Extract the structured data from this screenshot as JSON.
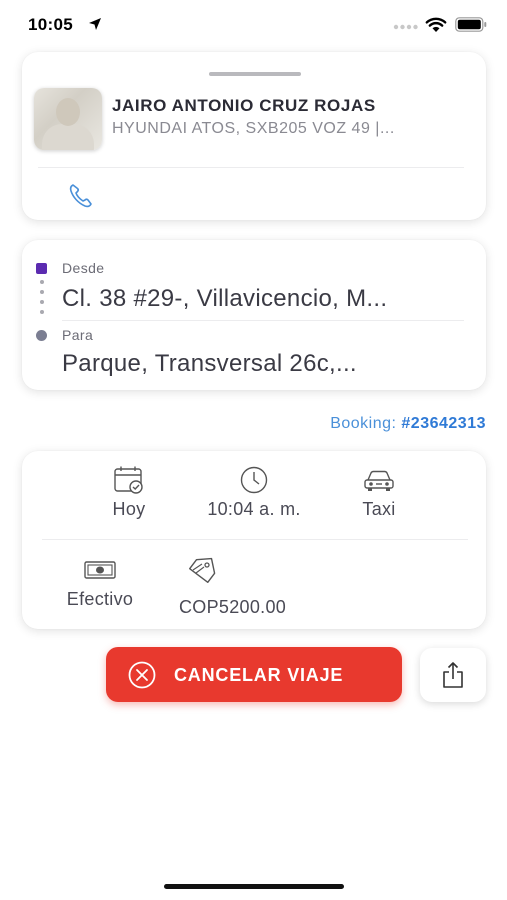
{
  "status_bar": {
    "time": "10:05",
    "icons": [
      "location-arrow-icon",
      "signal-icon",
      "wifi-icon",
      "battery-icon"
    ]
  },
  "driver": {
    "name": "JAIRO ANTONIO CRUZ ROJAS",
    "vehicle": "HYUNDAI ATOS, SXB205 VOZ 49 |...",
    "contact_icon": "phone-icon"
  },
  "route": {
    "from_label": "Desde",
    "from_value": "Cl. 38 #29-, Villavicencio, M...",
    "to_label": "Para",
    "to_value": "Parque, Transversal 26c,...",
    "from_color": "#5b2bb0",
    "to_color": "#7b7e92"
  },
  "booking": {
    "label": "Booking:",
    "id": "#23642313"
  },
  "trip_info": {
    "date": "Hoy",
    "time": "10:04 a. m.",
    "vehicle_type": "Taxi",
    "payment_method": "Efectivo",
    "fare": "COP5200.00"
  },
  "actions": {
    "cancel_label": "CANCELAR VIAJE",
    "cancel_color": "#e8392e",
    "share_icon": "share-icon"
  },
  "colors": {
    "accent_link": "#2f7ad6"
  }
}
